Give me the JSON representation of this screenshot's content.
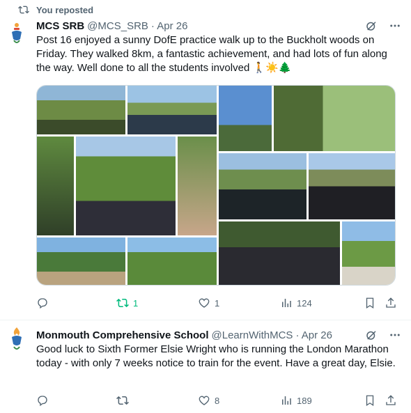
{
  "tweet1": {
    "repost_label": "You reposted",
    "name": "MCS SRB",
    "handle": "@MCS_SRB",
    "date": "· Apr 26",
    "text": "Post 16 enjoyed a sunny DofE practice walk up to the Buckholt woods on Friday. They walked 8km, a fantastic achievement, and had lots of fun along the way. Well done to all the students involved 🚶☀️🌲",
    "reply_count": "",
    "repost_count": "1",
    "like_count": "1",
    "views_count": "124"
  },
  "tweet2": {
    "name": "Monmouth Comprehensive School",
    "handle": "@LearnWithMCS",
    "date": "· Apr 26",
    "text": "Good luck to Sixth Former Elsie Wright who is running the London Marathon today - with only 7 weeks notice to train for the event.  Have a great day, Elsie.",
    "reply_count": "",
    "repost_count": "",
    "like_count": "8",
    "views_count": "189"
  },
  "icons": {
    "repost": "repost-icon",
    "reply": "reply-icon",
    "like": "heart-icon",
    "views": "views-icon",
    "bookmark": "bookmark-icon",
    "share": "share-icon",
    "grok": "grok-icon",
    "more": "more-icon"
  },
  "colors": {
    "muted": "#536471",
    "repost_active": "#00ba7c",
    "border": "#cfd9de"
  }
}
